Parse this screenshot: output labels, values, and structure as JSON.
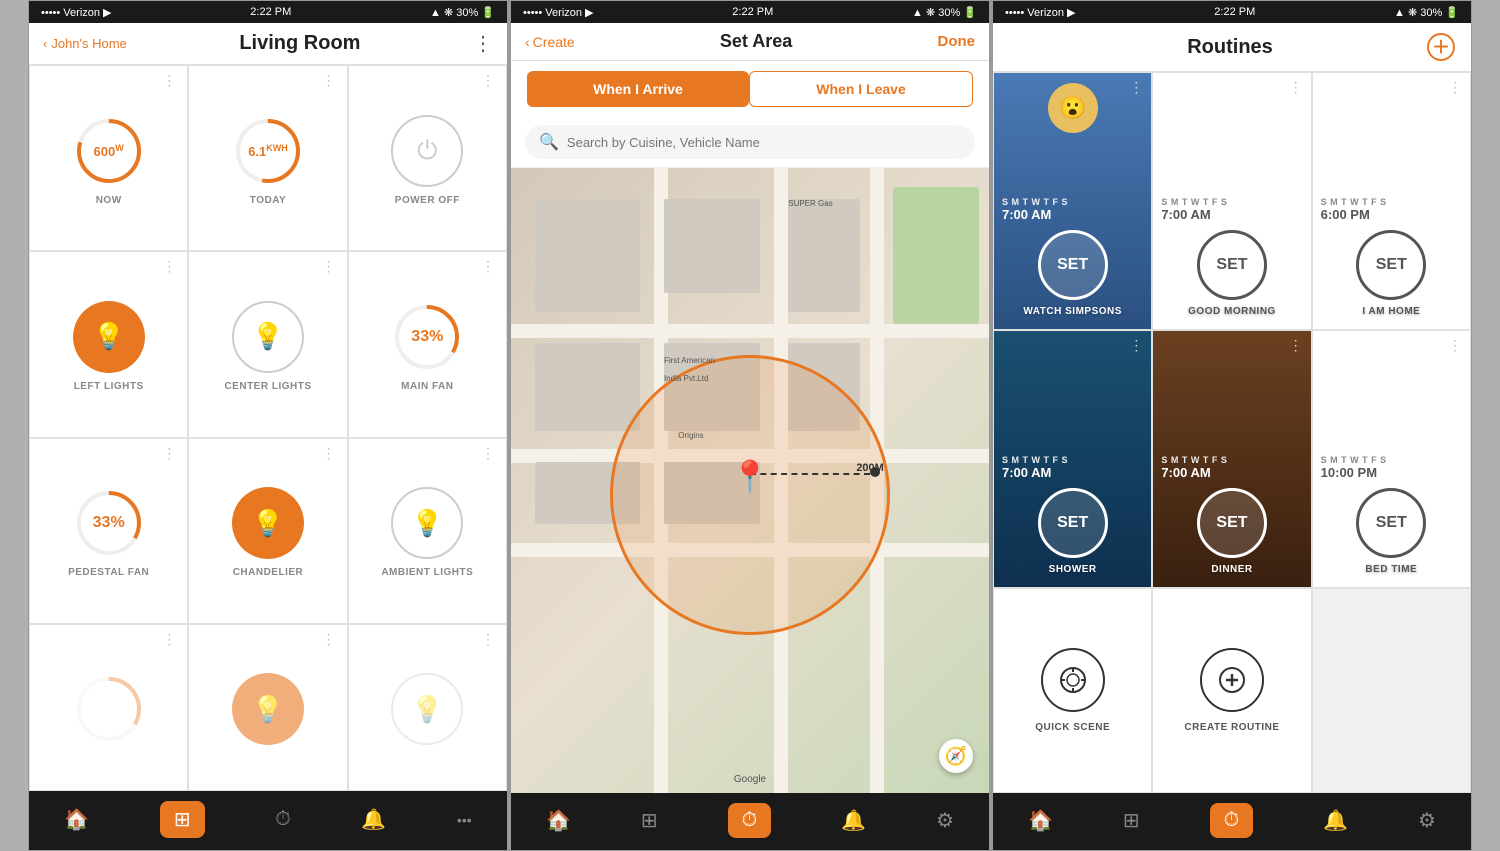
{
  "phone1": {
    "status": {
      "carrier": "••••• Verizon ▸",
      "time": "2:22 PM",
      "icons": "▲ ❋ 30% 🔋"
    },
    "header": {
      "back_label": "John's Home",
      "title": "Living Room",
      "menu": "⋮"
    },
    "cells": [
      {
        "id": "now",
        "type": "ring_orange",
        "value": "600",
        "unit": "W",
        "label": "NOW"
      },
      {
        "id": "today",
        "type": "ring_orange",
        "value": "6.1",
        "unit": "KWH",
        "label": "TODAY"
      },
      {
        "id": "power_off",
        "type": "power_outline",
        "label": "POWER OFF"
      },
      {
        "id": "left_lights",
        "type": "bulb_orange",
        "label": "LEFT LIGHTS"
      },
      {
        "id": "center_lights",
        "type": "bulb_outline",
        "label": "CENTER LIGHTS"
      },
      {
        "id": "main_fan",
        "type": "ring_pct",
        "value": "33%",
        "label": "MAIN FAN"
      },
      {
        "id": "pedestal_fan",
        "type": "ring_pct",
        "value": "33%",
        "label": "PEDESTAL FAN"
      },
      {
        "id": "chandelier",
        "type": "bulb_orange",
        "label": "CHANDELIER"
      },
      {
        "id": "ambient_lights",
        "type": "bulb_outline",
        "label": "AMBIENT LIGHTS"
      }
    ],
    "nav": [
      {
        "icon": "🏠",
        "active": false
      },
      {
        "icon": "⊞",
        "active": true
      },
      {
        "icon": "⏱",
        "active": false
      },
      {
        "icon": "🔔",
        "active": false
      },
      {
        "icon": "•••",
        "active": false
      }
    ]
  },
  "phone2": {
    "status": {
      "carrier": "••••• Verizon ▸",
      "time": "2:22 PM",
      "icons": "▲ ❋ 30% 🔋"
    },
    "header": {
      "back_label": "Create",
      "title": "Set Area",
      "done": "Done"
    },
    "toggle": {
      "arrive": "When I Arrive",
      "leave": "When I Leave"
    },
    "search_placeholder": "Search by Cuisine, Vehicle Name",
    "distance": "200M",
    "nav": [
      {
        "icon": "🏠",
        "active": false
      },
      {
        "icon": "⊞",
        "active": false
      },
      {
        "icon": "⏱",
        "active": true
      },
      {
        "icon": "🔔",
        "active": false
      },
      {
        "icon": "⚙",
        "active": false
      }
    ]
  },
  "phone3": {
    "status": {
      "carrier": "••••• Verizon ▸",
      "time": "2:22 PM",
      "icons": "▲ ❋ 30% 🔋"
    },
    "header": {
      "title": "Routines",
      "add": "+"
    },
    "routines": [
      {
        "id": "watch_simpsons",
        "days": "S M T W T F S",
        "time": "7:00 AM",
        "name": "WATCH SIMPSONS",
        "bg_type": "simpsons"
      },
      {
        "id": "good_morning",
        "days": "S M T W T F S",
        "time": "7:00 AM",
        "name": "GOOD MORNING",
        "bg_type": "light"
      },
      {
        "id": "i_am_home",
        "days": "S M T W T F S",
        "time": "6:00 PM",
        "name": "I AM HOME",
        "bg_type": "light"
      },
      {
        "id": "shower",
        "days": "S M T W T F S",
        "time": "7:00 AM",
        "name": "SHOWER",
        "bg_type": "shower"
      },
      {
        "id": "dinner",
        "days": "S M T W T F S",
        "time": "7:00 AM",
        "name": "DINNER",
        "bg_type": "dinner"
      },
      {
        "id": "bed_time",
        "days": "S M T W T F S",
        "time": "10:00 PM",
        "name": "BED TIME",
        "bg_type": "light"
      }
    ],
    "actions": [
      {
        "id": "quick_scene",
        "icon": "◎",
        "label": "QUICK SCENE"
      },
      {
        "id": "create_routine",
        "icon": "+",
        "label": "CREATE ROUTINE"
      }
    ],
    "nav": [
      {
        "icon": "🏠",
        "active": false
      },
      {
        "icon": "⊞",
        "active": false
      },
      {
        "icon": "⏱",
        "active": true
      },
      {
        "icon": "🔔",
        "active": false
      },
      {
        "icon": "⚙",
        "active": false
      }
    ]
  }
}
